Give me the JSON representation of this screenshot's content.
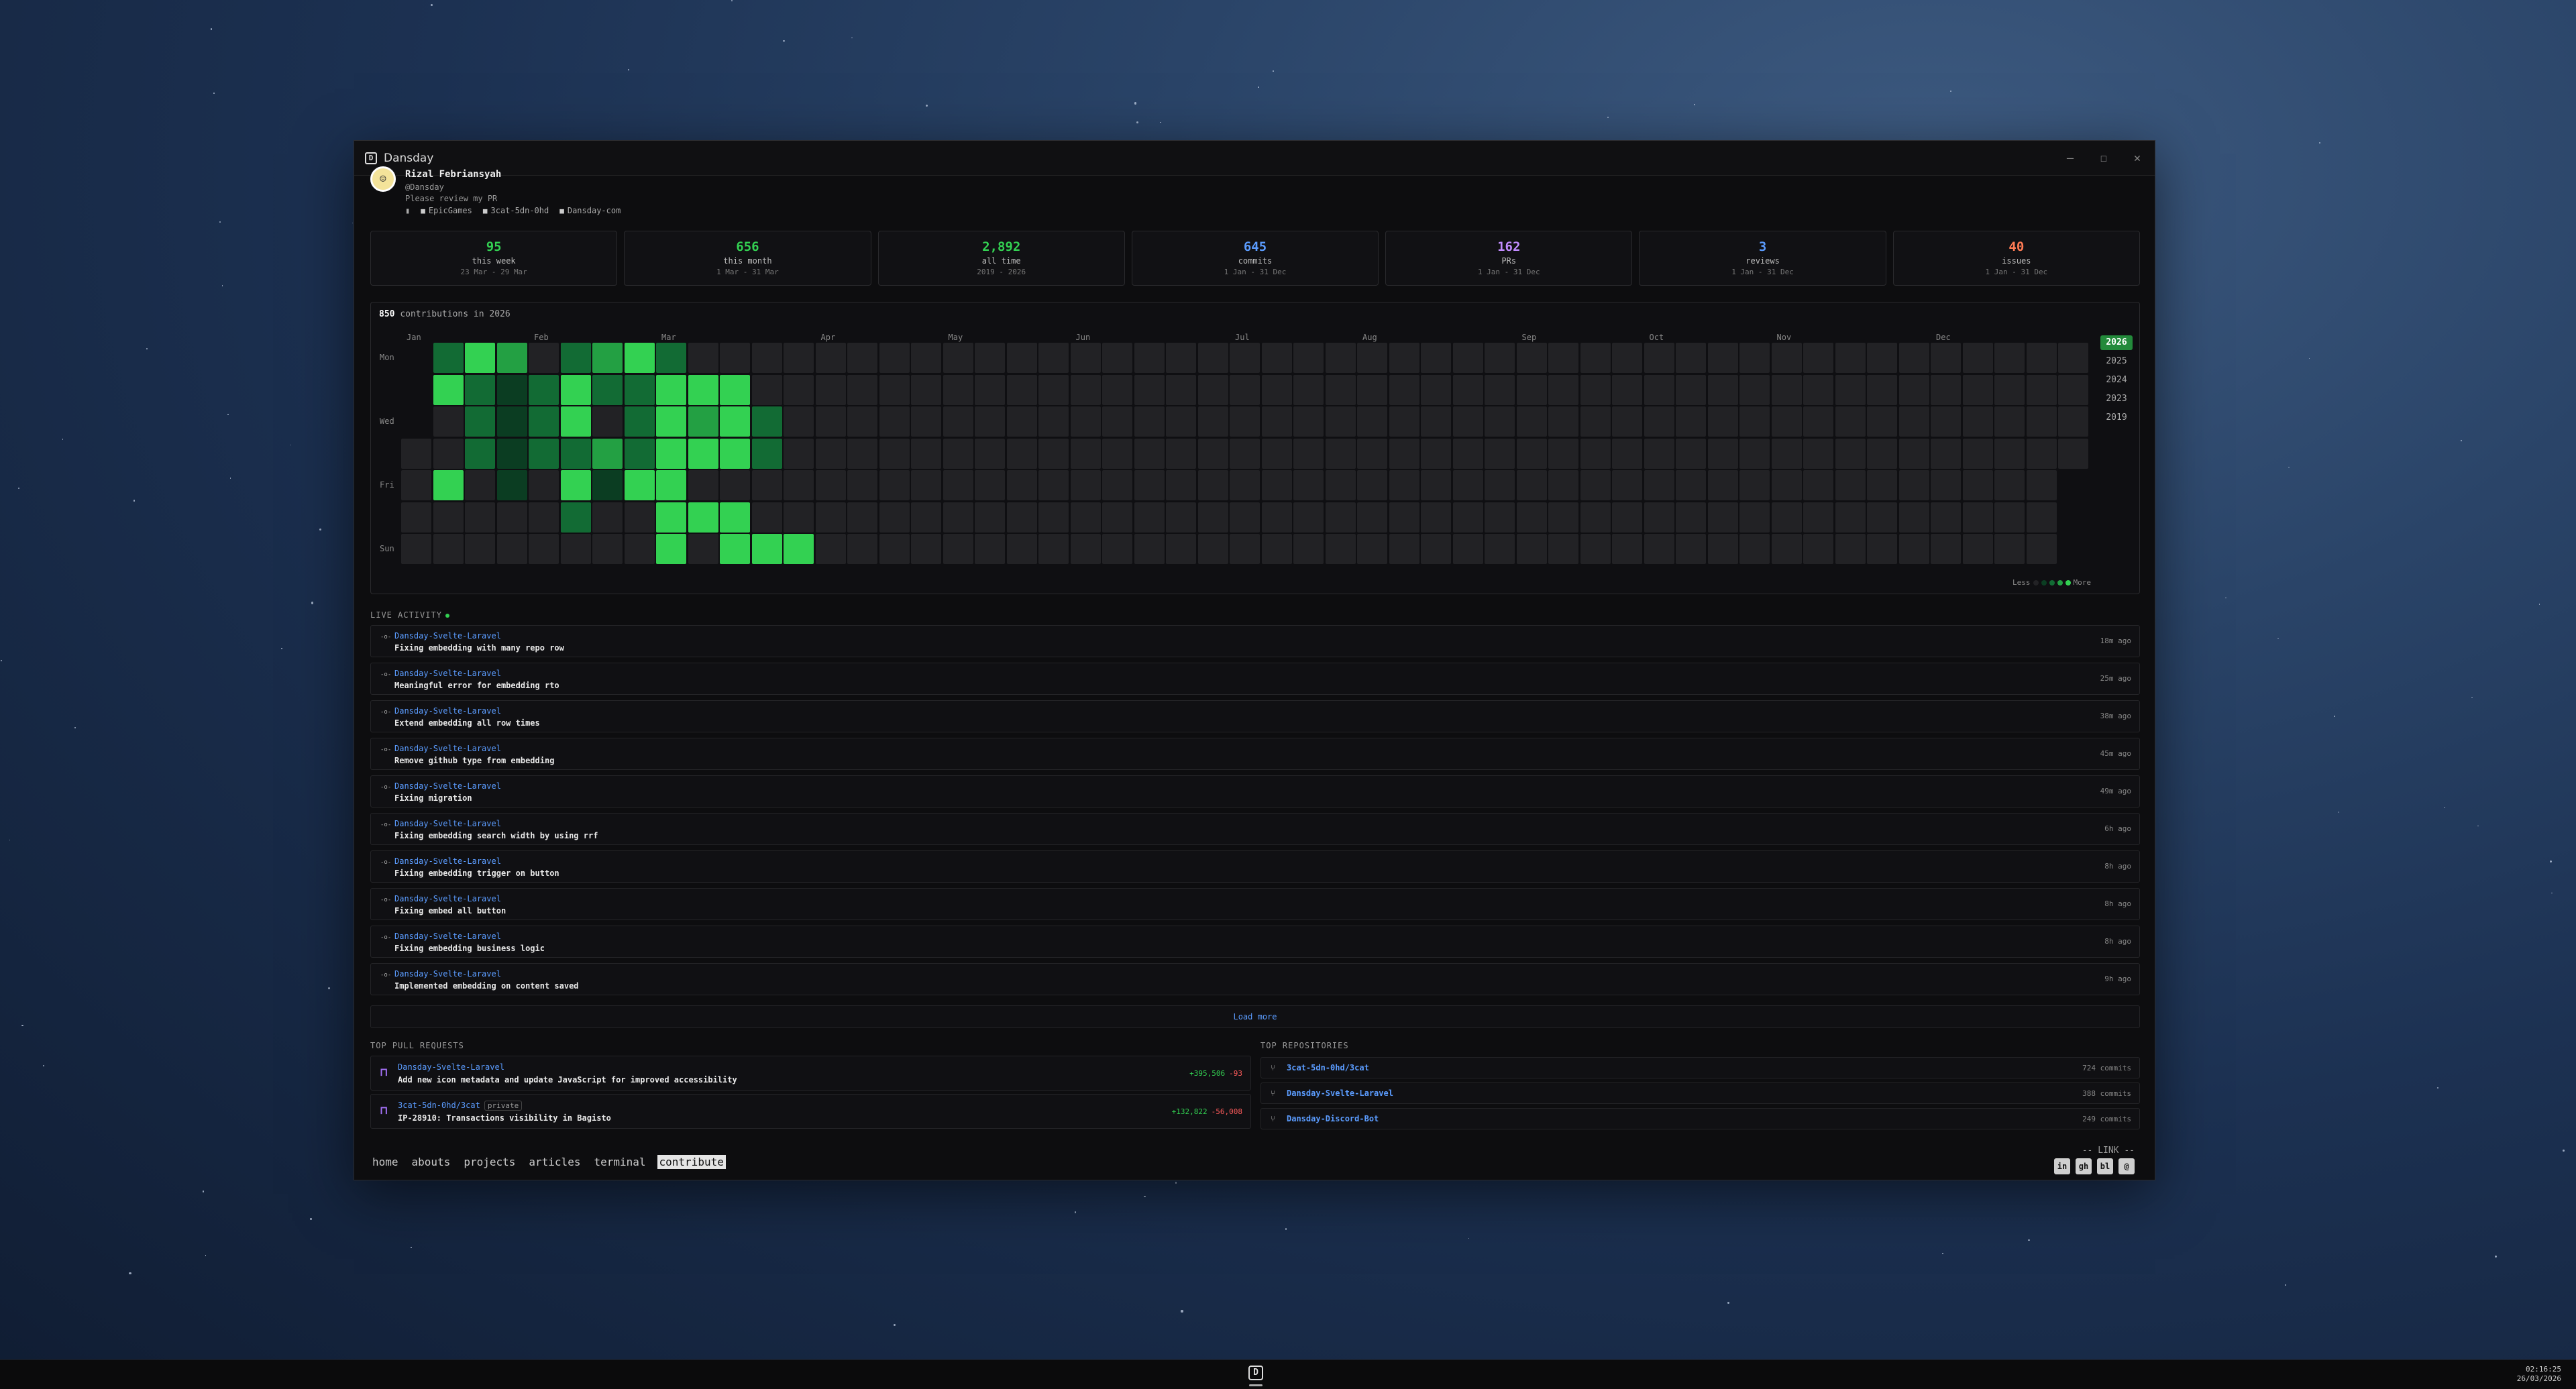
{
  "window": {
    "title": "Dansday",
    "controls": [
      "—",
      "☐",
      "✕"
    ]
  },
  "profile": {
    "name": "Rizal Febriansyah",
    "handle": "@Dansday",
    "bio": "Please review my PR",
    "orgs": [
      "EpicGames",
      "3cat-5dn-0hd",
      "Dansday-com"
    ]
  },
  "stats": [
    {
      "value": "95",
      "label": "this week",
      "range": "23 Mar - 29 Mar",
      "color": "#33d152"
    },
    {
      "value": "656",
      "label": "this month",
      "range": "1 Mar - 31 Mar",
      "color": "#33d152"
    },
    {
      "value": "2,892",
      "label": "all time",
      "range": "2019 - 2026",
      "color": "#33d152"
    },
    {
      "value": "645",
      "label": "commits",
      "range": "1 Jan - 31 Dec",
      "color": "#5b9cff"
    },
    {
      "value": "162",
      "label": "PRs",
      "range": "1 Jan - 31 Dec",
      "color": "#c28cff"
    },
    {
      "value": "3",
      "label": "reviews",
      "range": "1 Jan - 31 Dec",
      "color": "#5b9cff"
    },
    {
      "value": "40",
      "label": "issues",
      "range": "1 Jan - 31 Dec",
      "color": "#ff7b54"
    }
  ],
  "heatmap": {
    "count": "850",
    "count_suffix": "contributions in 2026",
    "months": [
      "Jan",
      "Feb",
      "Mar",
      "Apr",
      "May",
      "Jun",
      "Jul",
      "Aug",
      "Sep",
      "Oct",
      "Nov",
      "Dec"
    ],
    "day_labels": [
      "Mon",
      "Wed",
      "Fri",
      "Sun"
    ],
    "years": [
      "2026",
      "2025",
      "2024",
      "2023",
      "2019"
    ],
    "legend_less": "Less",
    "legend_more": "More",
    "levels": [
      "02430234200000000000000000000000000000000000000000000",
      "04212422444000000000000000000000000000000000000000000",
      "00212402434200000000000000000000000000000000000000000",
      "00212232444200000000000000000000000000000000000000000",
      "04010414400000000000000000000000000000000000000000000",
      "00000200444000000000000000000000000000000000000000000",
      "00000000404440000000000000000000000000000000000000000"
    ]
  },
  "live_activity": {
    "title": "LIVE ACTIVITY",
    "items": [
      {
        "repo": "Dansday-Svelte-Laravel",
        "message": "Fixing embedding with many repo row",
        "time": "18m ago"
      },
      {
        "repo": "Dansday-Svelte-Laravel",
        "message": "Meaningful error for embedding rto",
        "time": "25m ago"
      },
      {
        "repo": "Dansday-Svelte-Laravel",
        "message": "Extend embedding all row times",
        "time": "38m ago"
      },
      {
        "repo": "Dansday-Svelte-Laravel",
        "message": "Remove github type from embedding",
        "time": "45m ago"
      },
      {
        "repo": "Dansday-Svelte-Laravel",
        "message": "Fixing migration",
        "time": "49m ago"
      },
      {
        "repo": "Dansday-Svelte-Laravel",
        "message": "Fixing embedding search width by using rrf",
        "time": "6h ago"
      },
      {
        "repo": "Dansday-Svelte-Laravel",
        "message": "Fixing embedding trigger on button",
        "time": "8h ago"
      },
      {
        "repo": "Dansday-Svelte-Laravel",
        "message": "Fixing embed all button",
        "time": "8h ago"
      },
      {
        "repo": "Dansday-Svelte-Laravel",
        "message": "Fixing embedding business logic",
        "time": "8h ago"
      },
      {
        "repo": "Dansday-Svelte-Laravel",
        "message": "Implemented embedding on content saved",
        "time": "9h ago"
      }
    ],
    "load_more": "Load more"
  },
  "top_pull_requests": {
    "title": "TOP PULL REQUESTS",
    "items": [
      {
        "repo": "Dansday-Svelte-Laravel",
        "badge": "",
        "title": "Add new icon metadata and update JavaScript for improved accessibility",
        "add": "+395,506",
        "del": "-93"
      },
      {
        "repo": "3cat-5dn-0hd/3cat",
        "badge": "private",
        "title": "IP-28910: Transactions visibility in Bagisto",
        "add": "+132,822",
        "del": "-56,008"
      }
    ]
  },
  "top_repositories": {
    "title": "TOP REPOSITORIES",
    "items": [
      {
        "name": "3cat-5dn-0hd/3cat",
        "commits": "724 commits"
      },
      {
        "name": "Dansday-Svelte-Laravel",
        "commits": "388 commits"
      },
      {
        "name": "Dansday-Discord-Bot",
        "commits": "249 commits"
      }
    ]
  },
  "nav": [
    "home",
    "abouts",
    "projects",
    "articles",
    "terminal",
    "contribute"
  ],
  "link_label": "-- LINK --",
  "socials": [
    "in",
    "gh",
    "bl",
    "@"
  ],
  "taskbar": {
    "time": "02:16:25",
    "date": "26/03/2026"
  }
}
